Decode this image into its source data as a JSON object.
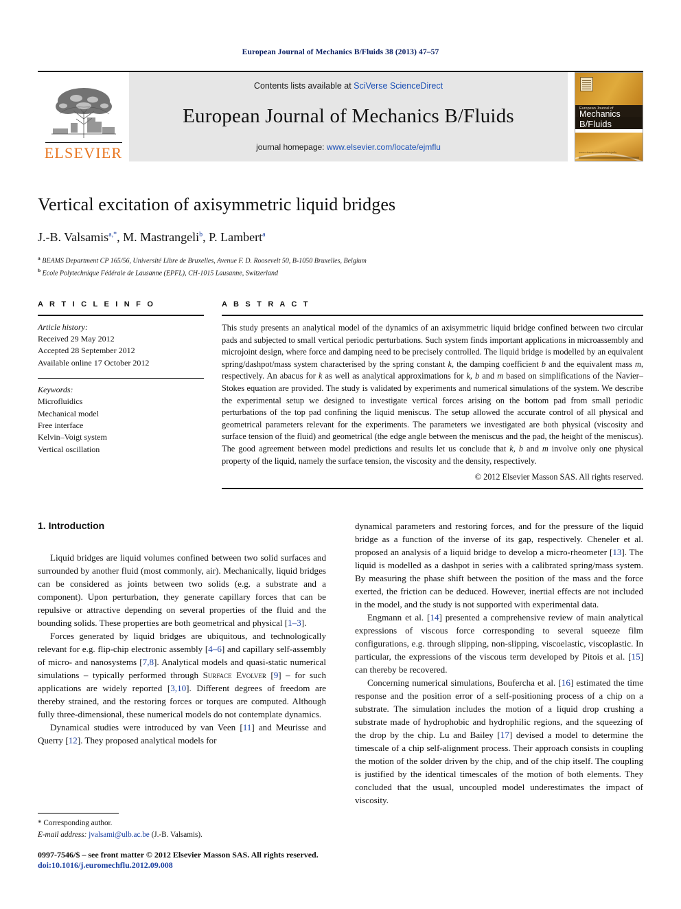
{
  "running_head": "European Journal of Mechanics B/Fluids 38 (2013) 47–57",
  "masthead": {
    "publisher_name": "ELSEVIER",
    "contents_prefix": "Contents lists available at ",
    "contents_link": "SciVerse ScienceDirect",
    "journal_title": "European Journal of Mechanics B/Fluids",
    "homepage_prefix": "journal homepage: ",
    "homepage_link": "www.elsevier.com/locate/ejmflu",
    "cover": {
      "line1": "European Journal of",
      "line2": "Mechanics",
      "line3": "B/Fluids",
      "footer": "www.elsevier.com/locate/ejmflu"
    }
  },
  "article": {
    "title": "Vertical excitation of axisymmetric liquid bridges",
    "authors_html": "J.-B. Valsamis<sup>a,*</sup>, M. Mastrangeli<sup>b</sup>, P. Lambert<sup>a</sup>",
    "affiliations": [
      {
        "marker": "a",
        "text": "BEAMS Department CP 165/56, Université Libre de Bruxelles, Avenue F. D. Roosevelt 50, B-1050 Bruxelles, Belgium"
      },
      {
        "marker": "b",
        "text": "Ecole Polytechnique Fédérale de Lausanne (EPFL), CH-1015 Lausanne, Switzerland"
      }
    ]
  },
  "info": {
    "heading": "A R T I C L E   I N F O",
    "history_label": "Article history:",
    "history": [
      "Received 29 May 2012",
      "Accepted 28 September 2012",
      "Available online 17 October 2012"
    ],
    "keywords_label": "Keywords:",
    "keywords": [
      "Microfluidics",
      "Mechanical model",
      "Free interface",
      "Kelvin–Voigt system",
      "Vertical oscillation"
    ]
  },
  "abstract": {
    "heading": "A B S T R A C T",
    "text": "This study presents an analytical model of the dynamics of an axisymmetric liquid bridge confined between two circular pads and subjected to small vertical periodic perturbations. Such system finds important applications in microassembly and microjoint design, where force and damping need to be precisely controlled. The liquid bridge is modelled by an equivalent spring/dashpot/mass system characterised by the spring constant k, the damping coefficient b and the equivalent mass m, respectively. An abacus for k as well as analytical approximations for k, b and m based on simplifications of the Navier–Stokes equation are provided. The study is validated by experiments and numerical simulations of the system. We describe the experimental setup we designed to investigate vertical forces arising on the bottom pad from small periodic perturbations of the top pad confining the liquid meniscus. The setup allowed the accurate control of all physical and geometrical parameters relevant for the experiments. The parameters we investigated are both physical (viscosity and surface tension of the fluid) and geometrical (the edge angle between the meniscus and the pad, the height of the meniscus). The good agreement between model predictions and results let us conclude that k, b and m involve only one physical property of the liquid, namely the surface tension, the viscosity and the density, respectively.",
    "copyright": "© 2012 Elsevier Masson SAS. All rights reserved."
  },
  "body": {
    "section_heading": "1. Introduction",
    "left_paragraphs": [
      "Liquid bridges are liquid volumes confined between two solid surfaces and surrounded by another fluid (most commonly, air). Mechanically, liquid bridges can be considered as joints between two solids (e.g. a substrate and a component). Upon perturbation, they generate capillary forces that can be repulsive or attractive depending on several properties of the fluid and the bounding solids. These properties are both geometrical and physical [1–3].",
      "Forces generated by liquid bridges are ubiquitous, and technologically relevant for e.g. flip-chip electronic assembly [4–6] and capillary self-assembly of micro- and nanosystems [7,8]. Analytical models and quasi-static numerical simulations – typically performed through Surface Evolver [9] – for such applications are widely reported [3,10]. Different degrees of freedom are thereby strained, and the restoring forces or torques are computed. Although fully three-dimensional, these numerical models do not contemplate dynamics.",
      "Dynamical studies were introduced by van Veen [11] and Meurisse and Querry [12]. They proposed analytical models for"
    ],
    "right_paragraphs": [
      "dynamical parameters and restoring forces, and for the pressure of the liquid bridge as a function of the inverse of its gap, respectively. Cheneler et al. proposed an analysis of a liquid bridge to develop a micro-rheometer [13]. The liquid is modelled as a dashpot in series with a calibrated spring/mass system. By measuring the phase shift between the position of the mass and the force exerted, the friction can be deduced. However, inertial effects are not included in the model, and the study is not supported with experimental data.",
      "Engmann et al. [14] presented a comprehensive review of main analytical expressions of viscous force corresponding to several squeeze film configurations, e.g. through slipping, non-slipping, viscoelastic, viscoplastic. In particular, the expressions of the viscous term developed by Pitois et al. [15] can thereby be recovered.",
      "Concerning numerical simulations, Boufercha et al. [16] estimated the time response and the position error of a self-positioning process of a chip on a substrate. The simulation includes the motion of a liquid drop crushing a substrate made of hydrophobic and hydrophilic regions, and the squeezing of the drop by the chip. Lu and Bailey [17] devised a model to determine the timescale of a chip self-alignment process. Their approach consists in coupling the motion of the solder driven by the chip, and of the chip itself. The coupling is justified by the identical timescales of the motion of both elements. They concluded that the usual, uncoupled model underestimates the impact of viscosity."
    ]
  },
  "footnote": {
    "corresponding": "* Corresponding author.",
    "email_label": "E-mail address:",
    "email": "jvalsami@ulb.ac.be",
    "email_owner": "(J.-B. Valsamis).",
    "issn": "0997-7546/$ – see front matter © 2012 Elsevier Masson SAS. All rights reserved.",
    "doi": "doi:10.1016/j.euromechflu.2012.09.008"
  },
  "colors": {
    "link_blue": "#1a4fb5",
    "ref_blue": "#1a3fa0",
    "elsevier_orange": "#E87722",
    "masthead_gray": "#e6e6e6"
  }
}
